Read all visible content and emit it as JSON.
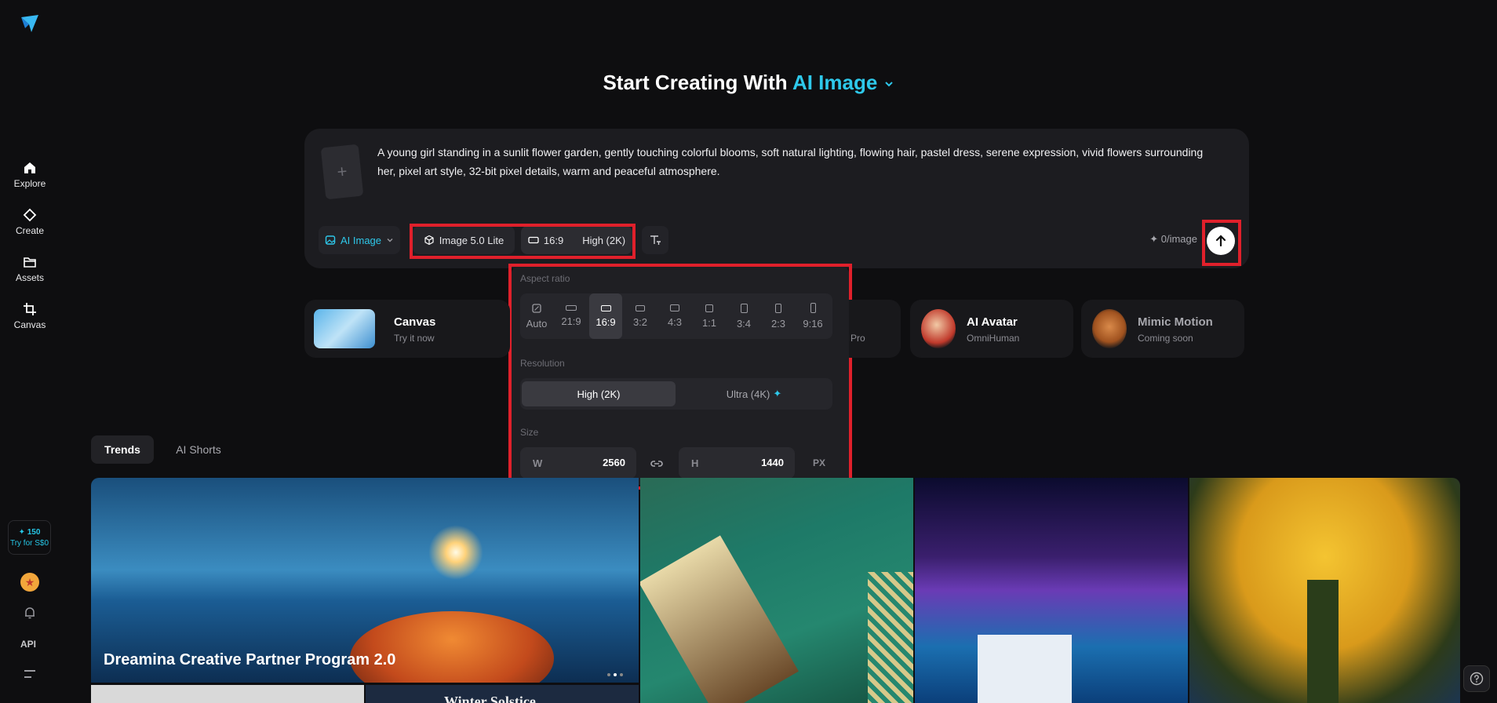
{
  "sidebar": {
    "items": [
      {
        "label": "Explore",
        "icon": "home-icon"
      },
      {
        "label": "Create",
        "icon": "diamond-icon"
      },
      {
        "label": "Assets",
        "icon": "folder-icon"
      },
      {
        "label": "Canvas",
        "icon": "crop-icon"
      }
    ],
    "credits": "✦ 150",
    "trial": "Try for S$0",
    "api_label": "API"
  },
  "header": {
    "title_prefix": "Start Creating With",
    "title_accent": "AI Image"
  },
  "prompt": {
    "text": "A young girl standing in a sunlit flower garden, gently touching colorful blooms, soft natural lighting, flowing hair, pastel dress, serene expression, vivid flowers surrounding her, pixel art style, 32-bit pixel details, warm and peaceful atmosphere.",
    "upload_symbol": "+",
    "mode_label": "AI Image",
    "model_label": "Image 5.0 Lite",
    "ratio_label": "16:9",
    "quality_label": "High (2K)",
    "cost_label": "✦ 0/image"
  },
  "dropdown": {
    "aspect_title": "Aspect ratio",
    "ratios": [
      "Auto",
      "21:9",
      "16:9",
      "3:2",
      "4:3",
      "1:1",
      "3:4",
      "2:3",
      "9:16"
    ],
    "selected_ratio": "16:9",
    "resolution_title": "Resolution",
    "resolutions": [
      "High (2K)",
      "Ultra (4K)"
    ],
    "ultra_mark": "✦",
    "size_title": "Size",
    "width_key": "W",
    "width_value": "2560",
    "height_key": "H",
    "height_value": "1440",
    "unit": "PX"
  },
  "features": [
    {
      "title": "Canvas",
      "subtitle": "Try it now"
    },
    {
      "title": "",
      "subtitle": "Pro"
    },
    {
      "title": "AI Avatar",
      "subtitle": "OmniHuman"
    },
    {
      "title": "Mimic Motion",
      "subtitle": "Coming soon"
    }
  ],
  "tabs": [
    "Trends",
    "AI Shorts"
  ],
  "gallery": {
    "banner_title": "Dreamina Creative Partner Program 2.0",
    "second_title": "Winter Solstice"
  },
  "colors": {
    "accent": "#2ec8ea",
    "highlight_border": "#e0202b",
    "background": "#0e0e10"
  }
}
